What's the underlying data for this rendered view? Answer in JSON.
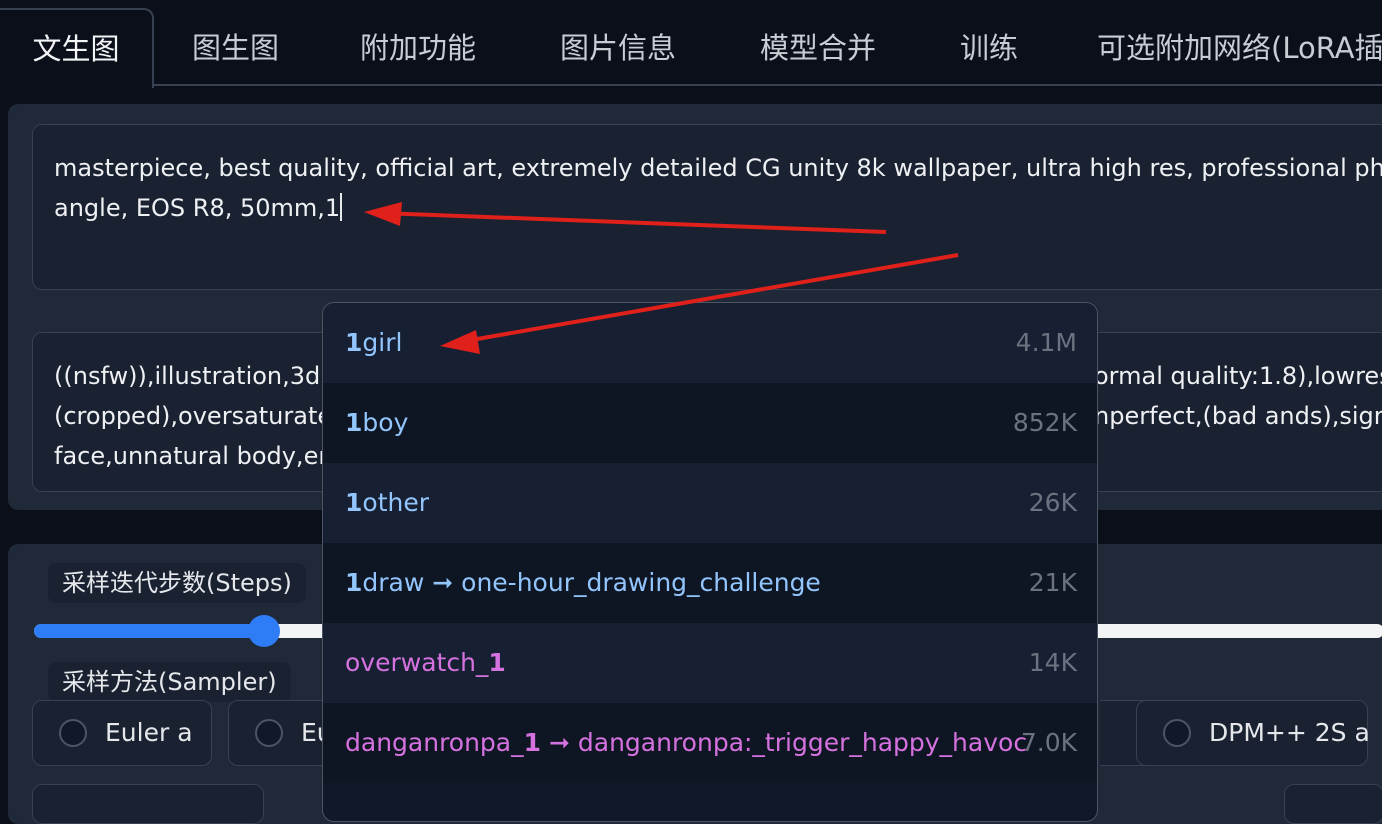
{
  "tabs": [
    {
      "label": "文生图",
      "active": true
    },
    {
      "label": "图生图"
    },
    {
      "label": "附加功能"
    },
    {
      "label": "图片信息"
    },
    {
      "label": "模型合并"
    },
    {
      "label": "训练"
    },
    {
      "label": "可选附加网络(LoRA插"
    }
  ],
  "prompt": {
    "line1": "masterpiece, best quality, official art, extremely detailed CG unity 8k wallpaper, ultra high res, professional photogr",
    "line2": "angle, EOS R8, 50mm,1"
  },
  "negative_prompt": {
    "line1_left": "((nsfw)),illustration,3d,",
    "line1_right": "ormal quality:1.8),lowres",
    "line2_left": "(cropped),oversaturate",
    "line2_right": "nperfect,(bad ands),signa",
    "line3_left": "face,unnatural body,err"
  },
  "settings": {
    "steps_label": "采样迭代步数(Steps)",
    "steps_fill_fraction": 0.17,
    "sampler_label": "采样方法(Sampler)",
    "samplers": [
      {
        "label": "Euler a"
      },
      {
        "label": "Eu"
      },
      {
        "label": "DPM++ 2S a"
      }
    ]
  },
  "autocomplete": {
    "items": [
      {
        "prefix": "1",
        "rest": "girl",
        "count": "4.1M",
        "color": "#93c5fd"
      },
      {
        "prefix": "1",
        "rest": "boy",
        "count": "852K",
        "color": "#93c5fd"
      },
      {
        "prefix": "1",
        "rest": "other",
        "count": "26K",
        "color": "#93c5fd"
      },
      {
        "prefix": "1",
        "rest": "draw ➞ one-hour_drawing_challenge",
        "count": "21K",
        "color": "#93c5fd"
      },
      {
        "prefix": "overwatch_",
        "rest": "1",
        "count": "14K",
        "color": "#d672e0"
      },
      {
        "prefix": "danganronpa_",
        "rest": "1 ➞ danganronpa:_trigger_happy_havoc",
        "count": "7.0K",
        "color": "#d672e0"
      }
    ]
  },
  "colors": {
    "accent": "#2f7df6",
    "arrow": "#e0201a",
    "general_tag": "#93c5fd",
    "copyright_tag": "#d672e0"
  }
}
